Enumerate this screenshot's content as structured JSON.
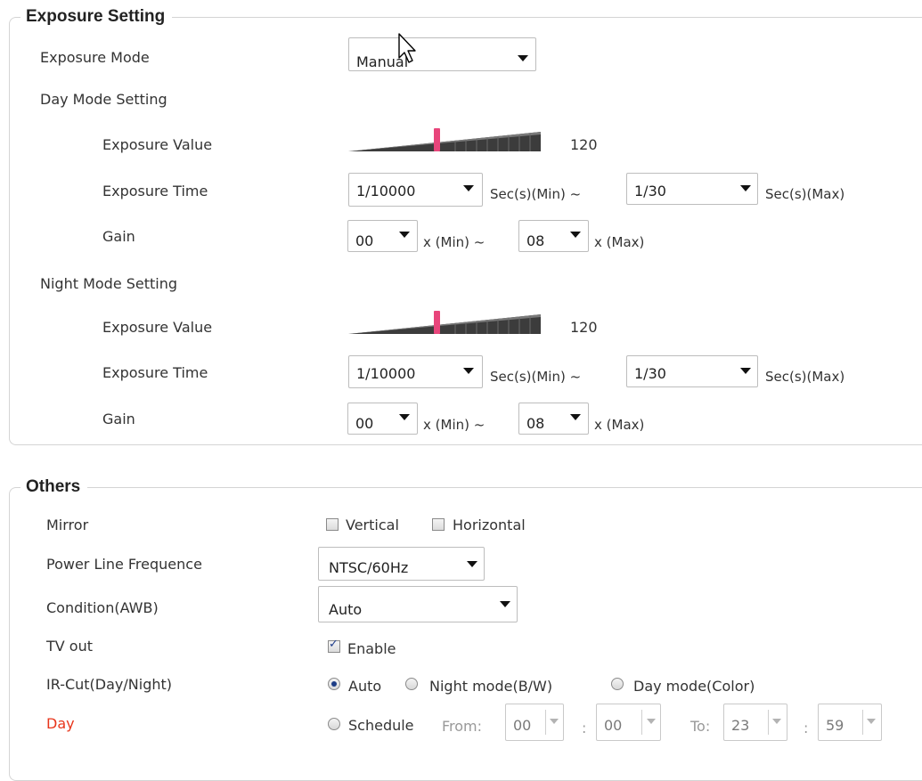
{
  "exposure": {
    "legend": "Exposure Setting",
    "mode_label": "Exposure Mode",
    "mode_value": "Manual",
    "day": {
      "title": "Day Mode Setting",
      "ev_label": "Exposure Value",
      "ev_value": "120",
      "ev_level": 0.46,
      "time_label": "Exposure Time",
      "time_min": "1/10000",
      "time_min_unit": "Sec(s)(Min) ~",
      "time_max": "1/30",
      "time_max_unit": "Sec(s)(Max)",
      "gain_label": "Gain",
      "gain_min": "00",
      "gain_min_unit": "x (Min) ~",
      "gain_max": "08",
      "gain_max_unit": "x (Max)"
    },
    "night": {
      "title": "Night Mode Setting",
      "ev_label": "Exposure Value",
      "ev_value": "120",
      "ev_level": 0.46,
      "time_label": "Exposure Time",
      "time_min": "1/10000",
      "time_min_unit": "Sec(s)(Min) ~",
      "time_max": "1/30",
      "time_max_unit": "Sec(s)(Max)",
      "gain_label": "Gain",
      "gain_min": "00",
      "gain_min_unit": "x (Min) ~",
      "gain_max": "08",
      "gain_max_unit": "x (Max)"
    }
  },
  "others": {
    "legend": "Others",
    "mirror_label": "Mirror",
    "mirror_vertical": "Vertical",
    "mirror_horizontal": "Horizontal",
    "power_label": "Power Line Frequence",
    "power_value": "NTSC/60Hz",
    "awb_label": "Condition(AWB)",
    "awb_value": "Auto",
    "tv_label": "TV out",
    "tv_enable": "Enable",
    "ircut_label": "IR-Cut(Day/Night)",
    "ircut_auto": "Auto",
    "ircut_night": "Night mode(B/W)",
    "ircut_day": "Day mode(Color)",
    "day_label": "Day",
    "schedule": "Schedule",
    "from": "From:",
    "to": "To:",
    "from_h": "00",
    "from_m": "00",
    "to_h": "23",
    "to_m": "59",
    "colon": ":"
  },
  "colors": {
    "slider_thumb": "#e8457b",
    "day_label": "#e8361c"
  }
}
